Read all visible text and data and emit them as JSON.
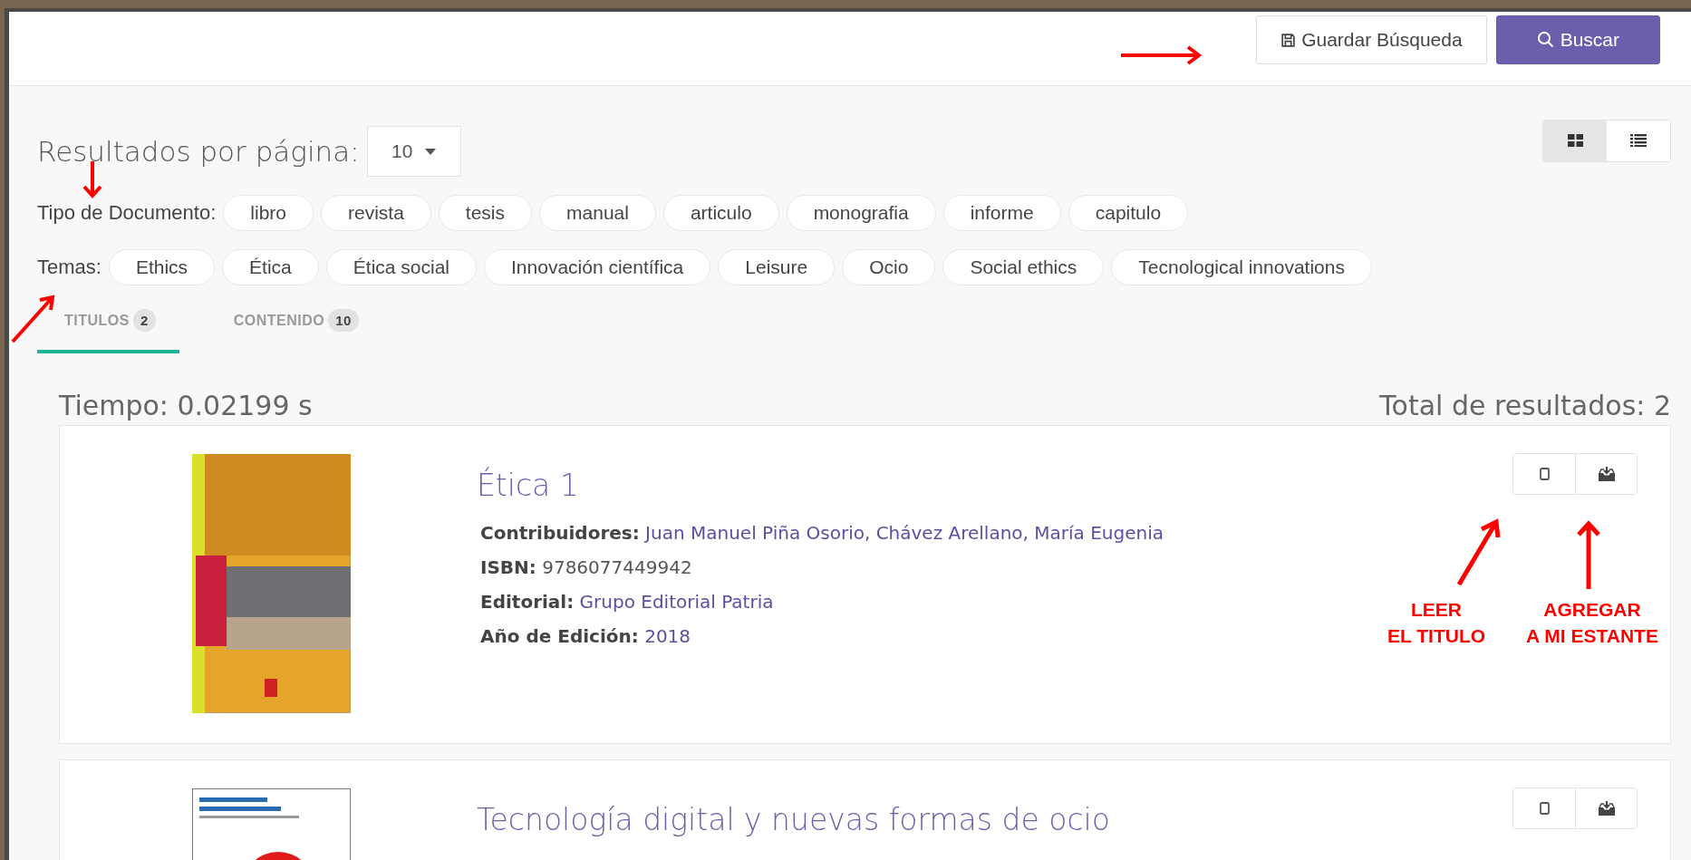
{
  "header": {
    "buttons": [
      {
        "label": "Guardar Búsqueda",
        "kind": "save"
      },
      {
        "label": "Buscar",
        "kind": "search"
      }
    ]
  },
  "per_page": {
    "label": "Resultados por página:",
    "value": "10"
  },
  "view_toggle": [
    {
      "kind": "grid",
      "selected": true
    },
    {
      "kind": "list",
      "selected": false
    }
  ],
  "filters": [
    {
      "label": "Tipo de Documento:",
      "chips": [
        "libro",
        "revista",
        "tesis",
        "manual",
        "articulo",
        "monografia",
        "informe",
        "capitulo"
      ]
    },
    {
      "label": "Temas:",
      "chips": [
        "Ethics",
        "Ética",
        "Ética social",
        "Innovación científica",
        "Leisure",
        "Ocio",
        "Social ethics",
        "Tecnological innovations"
      ]
    }
  ],
  "tabs": [
    {
      "label": "TITULOS",
      "count": "2",
      "selected": true
    },
    {
      "label": "CONTENIDO",
      "count": "10",
      "selected": false
    }
  ],
  "summary": {
    "time": "Tiempo: 0.02199 s",
    "total": "Total de resultados: 2"
  },
  "results": [
    {
      "title": "Ética 1",
      "kind": "photo",
      "fields": [
        {
          "label": "Contribuidores:",
          "value": "Juan Manuel Piña Osorio, Chávez Arellano, María Eugenia",
          "link": true
        },
        {
          "label": "ISBN:",
          "value": "9786077449942",
          "link": false
        },
        {
          "label": "Editorial:",
          "value": "Grupo Editorial Patria",
          "link": true
        },
        {
          "label": "Año de Edición:",
          "value": "2018",
          "link": true
        }
      ]
    },
    {
      "title": "Tecnología digital y nuevas formas de ocio",
      "kind": "plain"
    }
  ],
  "annotations": [
    {
      "kind": "read",
      "lines": [
        "LEER",
        "EL TITULO"
      ]
    },
    {
      "kind": "shelf",
      "lines": [
        "AGREGAR",
        "A MI ESTANTE"
      ]
    }
  ]
}
